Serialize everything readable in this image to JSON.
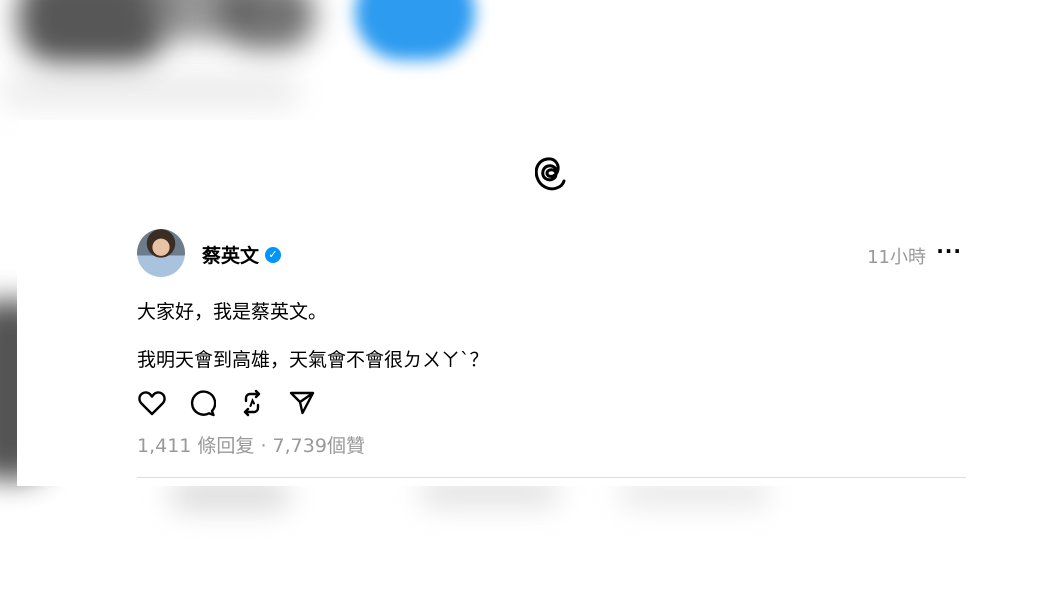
{
  "post": {
    "username": "蔡英文",
    "timestamp": "11小時",
    "more_icon": "more-horizontal-icon",
    "lines": [
      "大家好，我是蔡英文。",
      "我明天會到高雄，天氣會不會很ㄉㄨㄚˋ？"
    ],
    "stats": "1,411 條回复 · 7,739個贊"
  },
  "actions": {
    "like": "heart-icon",
    "reply": "comment-icon",
    "repost": "repost-icon",
    "share": "send-icon"
  },
  "colors": {
    "accent": "#0095f6",
    "secondary_text": "#999999"
  }
}
